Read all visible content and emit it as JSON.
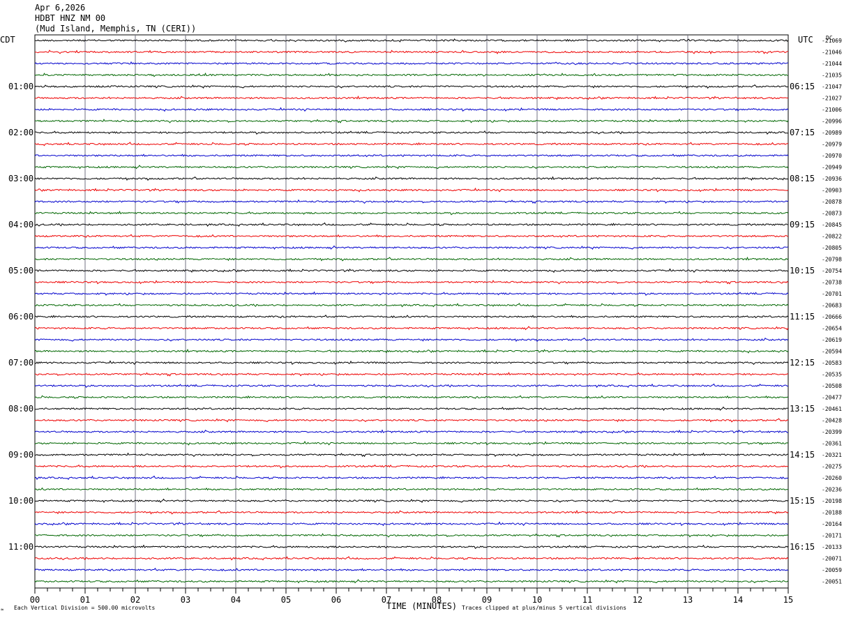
{
  "header": {
    "date": "Apr 6,2026",
    "station": "HDBT HNZ NM 00",
    "location": "(Mud Island, Memphis, TN (CERI))"
  },
  "left_axis_label": "CDT",
  "right_axis_label": "UTC",
  "dc_label": "DC",
  "x_axis_title": "TIME (MINUTES)",
  "footer": {
    "scale_note": "Each Vertical Division =  500.00 microvolts",
    "clip_note": "Traces clipped at plus/minus 5 vertical divisions"
  },
  "colors": {
    "trace_cycle": [
      "#000000",
      "#ee0000",
      "#0000cc",
      "#006600"
    ],
    "minute_grid": "#707080"
  },
  "chart_data": {
    "type": "line",
    "description_kind": "helicorder seismogram",
    "x_ticks": [
      "00",
      "01",
      "02",
      "03",
      "04",
      "05",
      "06",
      "07",
      "08",
      "09",
      "10",
      "11",
      "12",
      "13",
      "14",
      "15"
    ],
    "xlim": [
      0,
      15
    ],
    "traces_per_hour": 4,
    "local_time_labels": [
      "01:00",
      "02:00",
      "03:00",
      "04:00",
      "05:00",
      "06:00",
      "07:00",
      "08:00",
      "09:00",
      "10:00",
      "11:00"
    ],
    "utc_time_labels": [
      "06:15",
      "07:15",
      "08:15",
      "09:15",
      "10:15",
      "11:15",
      "12:15",
      "13:15",
      "14:15",
      "15:15",
      "16:15"
    ],
    "dc_offsets": [
      "-21069",
      "-21046",
      "-21044",
      "-21035",
      "-21047",
      "-21027",
      "-21006",
      "-20996",
      "-20989",
      "-20979",
      "-20970",
      "-20949",
      "-20936",
      "-20903",
      "-20878",
      "-20873",
      "-20845",
      "-20822",
      "-20805",
      "-20798",
      "-20754",
      "-20738",
      "-20701",
      "-20683",
      "-20666",
      "-20654",
      "-20619",
      "-20594",
      "-20583",
      "-20535",
      "-20508",
      "-20477",
      "-20461",
      "-20428",
      "-20399",
      "-20361",
      "-20321",
      "-20275",
      "-20260",
      "-20236",
      "-20198",
      "-20188",
      "-20164",
      "-20171",
      "-20133",
      "-20071",
      "-20059",
      "-20051"
    ]
  }
}
